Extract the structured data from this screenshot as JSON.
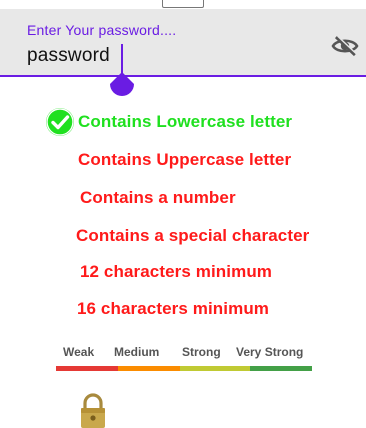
{
  "top_badge": {
    "text": ""
  },
  "password_field": {
    "label": "Enter Your password....",
    "value": "password",
    "visibility_icon": "eye-off-icon",
    "accent_color": "#6a1ce3"
  },
  "requirements": [
    {
      "text": "Contains Lowercase letter",
      "met": true,
      "icon": "check-circle-icon"
    },
    {
      "text": "Contains Uppercase letter",
      "met": false
    },
    {
      "text": "Contains a number",
      "met": false
    },
    {
      "text": "Contains a special character",
      "met": false
    },
    {
      "text": "12 characters minimum",
      "met": false
    },
    {
      "text": "16 characters minimum",
      "met": false
    }
  ],
  "colors": {
    "met": "#1fe01f",
    "unmet": "#ff1a1a"
  },
  "strength_meter": {
    "levels": [
      {
        "label": "Weak",
        "color": "#e53935"
      },
      {
        "label": "Medium",
        "color": "#fb8c00"
      },
      {
        "label": "Strong",
        "color": "#c0ca33"
      },
      {
        "label": "Very Strong",
        "color": "#43a047"
      }
    ]
  },
  "lock": {
    "icon": "padlock-icon"
  }
}
